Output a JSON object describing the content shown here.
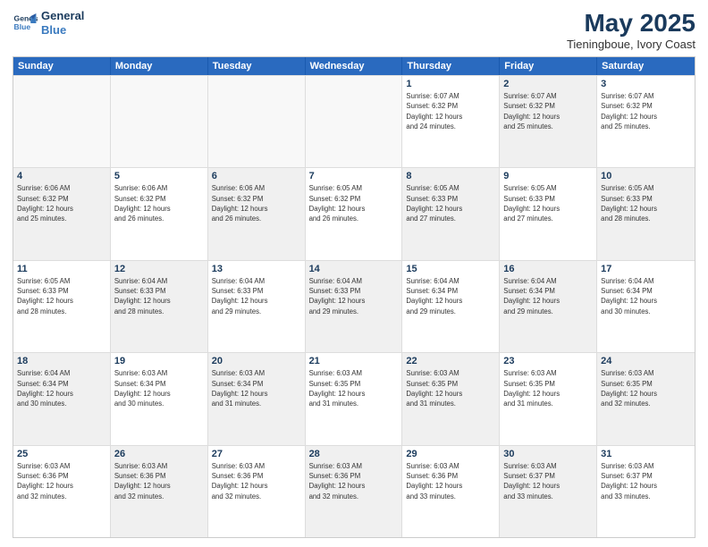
{
  "logo": {
    "line1": "General",
    "line2": "Blue"
  },
  "header": {
    "month": "May 2025",
    "location": "Tieningboue, Ivory Coast"
  },
  "weekdays": [
    "Sunday",
    "Monday",
    "Tuesday",
    "Wednesday",
    "Thursday",
    "Friday",
    "Saturday"
  ],
  "weeks": [
    [
      {
        "day": "",
        "empty": true,
        "shaded": false,
        "info": ""
      },
      {
        "day": "",
        "empty": true,
        "shaded": false,
        "info": ""
      },
      {
        "day": "",
        "empty": true,
        "shaded": false,
        "info": ""
      },
      {
        "day": "",
        "empty": true,
        "shaded": false,
        "info": ""
      },
      {
        "day": "1",
        "empty": false,
        "shaded": false,
        "info": "Sunrise: 6:07 AM\nSunset: 6:32 PM\nDaylight: 12 hours\nand 24 minutes."
      },
      {
        "day": "2",
        "empty": false,
        "shaded": true,
        "info": "Sunrise: 6:07 AM\nSunset: 6:32 PM\nDaylight: 12 hours\nand 25 minutes."
      },
      {
        "day": "3",
        "empty": false,
        "shaded": false,
        "info": "Sunrise: 6:07 AM\nSunset: 6:32 PM\nDaylight: 12 hours\nand 25 minutes."
      }
    ],
    [
      {
        "day": "4",
        "empty": false,
        "shaded": true,
        "info": "Sunrise: 6:06 AM\nSunset: 6:32 PM\nDaylight: 12 hours\nand 25 minutes."
      },
      {
        "day": "5",
        "empty": false,
        "shaded": false,
        "info": "Sunrise: 6:06 AM\nSunset: 6:32 PM\nDaylight: 12 hours\nand 26 minutes."
      },
      {
        "day": "6",
        "empty": false,
        "shaded": true,
        "info": "Sunrise: 6:06 AM\nSunset: 6:32 PM\nDaylight: 12 hours\nand 26 minutes."
      },
      {
        "day": "7",
        "empty": false,
        "shaded": false,
        "info": "Sunrise: 6:05 AM\nSunset: 6:32 PM\nDaylight: 12 hours\nand 26 minutes."
      },
      {
        "day": "8",
        "empty": false,
        "shaded": true,
        "info": "Sunrise: 6:05 AM\nSunset: 6:33 PM\nDaylight: 12 hours\nand 27 minutes."
      },
      {
        "day": "9",
        "empty": false,
        "shaded": false,
        "info": "Sunrise: 6:05 AM\nSunset: 6:33 PM\nDaylight: 12 hours\nand 27 minutes."
      },
      {
        "day": "10",
        "empty": false,
        "shaded": true,
        "info": "Sunrise: 6:05 AM\nSunset: 6:33 PM\nDaylight: 12 hours\nand 28 minutes."
      }
    ],
    [
      {
        "day": "11",
        "empty": false,
        "shaded": false,
        "info": "Sunrise: 6:05 AM\nSunset: 6:33 PM\nDaylight: 12 hours\nand 28 minutes."
      },
      {
        "day": "12",
        "empty": false,
        "shaded": true,
        "info": "Sunrise: 6:04 AM\nSunset: 6:33 PM\nDaylight: 12 hours\nand 28 minutes."
      },
      {
        "day": "13",
        "empty": false,
        "shaded": false,
        "info": "Sunrise: 6:04 AM\nSunset: 6:33 PM\nDaylight: 12 hours\nand 29 minutes."
      },
      {
        "day": "14",
        "empty": false,
        "shaded": true,
        "info": "Sunrise: 6:04 AM\nSunset: 6:33 PM\nDaylight: 12 hours\nand 29 minutes."
      },
      {
        "day": "15",
        "empty": false,
        "shaded": false,
        "info": "Sunrise: 6:04 AM\nSunset: 6:34 PM\nDaylight: 12 hours\nand 29 minutes."
      },
      {
        "day": "16",
        "empty": false,
        "shaded": true,
        "info": "Sunrise: 6:04 AM\nSunset: 6:34 PM\nDaylight: 12 hours\nand 29 minutes."
      },
      {
        "day": "17",
        "empty": false,
        "shaded": false,
        "info": "Sunrise: 6:04 AM\nSunset: 6:34 PM\nDaylight: 12 hours\nand 30 minutes."
      }
    ],
    [
      {
        "day": "18",
        "empty": false,
        "shaded": true,
        "info": "Sunrise: 6:04 AM\nSunset: 6:34 PM\nDaylight: 12 hours\nand 30 minutes."
      },
      {
        "day": "19",
        "empty": false,
        "shaded": false,
        "info": "Sunrise: 6:03 AM\nSunset: 6:34 PM\nDaylight: 12 hours\nand 30 minutes."
      },
      {
        "day": "20",
        "empty": false,
        "shaded": true,
        "info": "Sunrise: 6:03 AM\nSunset: 6:34 PM\nDaylight: 12 hours\nand 31 minutes."
      },
      {
        "day": "21",
        "empty": false,
        "shaded": false,
        "info": "Sunrise: 6:03 AM\nSunset: 6:35 PM\nDaylight: 12 hours\nand 31 minutes."
      },
      {
        "day": "22",
        "empty": false,
        "shaded": true,
        "info": "Sunrise: 6:03 AM\nSunset: 6:35 PM\nDaylight: 12 hours\nand 31 minutes."
      },
      {
        "day": "23",
        "empty": false,
        "shaded": false,
        "info": "Sunrise: 6:03 AM\nSunset: 6:35 PM\nDaylight: 12 hours\nand 31 minutes."
      },
      {
        "day": "24",
        "empty": false,
        "shaded": true,
        "info": "Sunrise: 6:03 AM\nSunset: 6:35 PM\nDaylight: 12 hours\nand 32 minutes."
      }
    ],
    [
      {
        "day": "25",
        "empty": false,
        "shaded": false,
        "info": "Sunrise: 6:03 AM\nSunset: 6:36 PM\nDaylight: 12 hours\nand 32 minutes."
      },
      {
        "day": "26",
        "empty": false,
        "shaded": true,
        "info": "Sunrise: 6:03 AM\nSunset: 6:36 PM\nDaylight: 12 hours\nand 32 minutes."
      },
      {
        "day": "27",
        "empty": false,
        "shaded": false,
        "info": "Sunrise: 6:03 AM\nSunset: 6:36 PM\nDaylight: 12 hours\nand 32 minutes."
      },
      {
        "day": "28",
        "empty": false,
        "shaded": true,
        "info": "Sunrise: 6:03 AM\nSunset: 6:36 PM\nDaylight: 12 hours\nand 32 minutes."
      },
      {
        "day": "29",
        "empty": false,
        "shaded": false,
        "info": "Sunrise: 6:03 AM\nSunset: 6:36 PM\nDaylight: 12 hours\nand 33 minutes."
      },
      {
        "day": "30",
        "empty": false,
        "shaded": true,
        "info": "Sunrise: 6:03 AM\nSunset: 6:37 PM\nDaylight: 12 hours\nand 33 minutes."
      },
      {
        "day": "31",
        "empty": false,
        "shaded": false,
        "info": "Sunrise: 6:03 AM\nSunset: 6:37 PM\nDaylight: 12 hours\nand 33 minutes."
      }
    ]
  ]
}
